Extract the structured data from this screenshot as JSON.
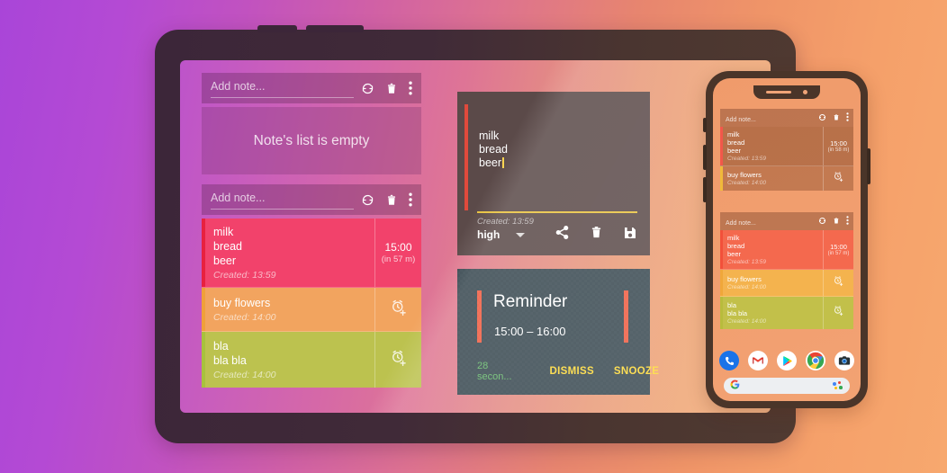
{
  "background": {
    "gradient_from": "#a945d8",
    "gradient_mid": "#dd7290",
    "gradient_to": "#f7a86e"
  },
  "tablet": {
    "bezel_color": "#3c2639",
    "empty_list_panel": {
      "toolbar": {
        "placeholder": "Add note...",
        "icons": [
          "sync-icon",
          "delete-icon",
          "overflow-menu-icon"
        ]
      },
      "empty_message": "Note's list is empty"
    },
    "notes_panel": {
      "toolbar": {
        "placeholder": "Add note...",
        "icons": [
          "sync-icon",
          "delete-icon",
          "overflow-menu-icon"
        ]
      },
      "notes": [
        {
          "lines": [
            "milk",
            "bread",
            "beer"
          ],
          "created": "Created: 13:59",
          "time": "15:00",
          "relative": "(in 57 m)",
          "color": "#f2426b",
          "bar_color": "#e8213f",
          "has_reminder": true
        },
        {
          "lines": [
            "buy flowers"
          ],
          "created": "Created: 14:00",
          "time": "",
          "relative": "",
          "color": "#f2a45f",
          "bar_color": "#f0a03a",
          "has_reminder": false
        },
        {
          "lines": [
            "bla",
            "bla bla"
          ],
          "created": "Created: 14:00",
          "time": "",
          "relative": "",
          "color": "#bcc24f",
          "bar_color": "#a8c23c",
          "has_reminder": false
        }
      ]
    },
    "editor": {
      "background": "#5b4a49",
      "accent_bar": "#e04a3c",
      "underline": "#e8c23f",
      "lines": [
        "milk",
        "bread",
        "beer"
      ],
      "created": "Created: 13:59",
      "priority": "high",
      "icons": [
        "share-icon",
        "delete-icon",
        "save-icon"
      ]
    },
    "reminder": {
      "background": "#37474f",
      "accent_bar": "#ef5a3f",
      "title": "Reminder",
      "time_range": "15:00 – 16:00",
      "countdown": "28 secon...",
      "countdown_color": "#66bb6a",
      "dismiss_label": "DISMISS",
      "snooze_label": "SNOOZE",
      "action_color": "#fdd835"
    }
  },
  "phone": {
    "bezel_color": "#4a3529",
    "wallpaper": "#f09b6b",
    "dark_panel": {
      "toolbar": {
        "placeholder": "Add note...",
        "icons": [
          "sync-icon",
          "delete-icon",
          "overflow-menu-icon"
        ]
      },
      "notes": [
        {
          "lines": [
            "milk",
            "bread",
            "beer"
          ],
          "created": "Created: 13:59",
          "time": "15:00",
          "relative": "(in 58 m)",
          "color": "rgba(150,85,52,0.62)",
          "bar_color": "#f2574a",
          "has_reminder": false
        },
        {
          "lines": [
            "buy flowers"
          ],
          "created": "Created: 14:00",
          "time": "",
          "relative": "",
          "color": "rgba(150,85,52,0.50)",
          "bar_color": "#f0b93a",
          "has_reminder": true
        }
      ]
    },
    "color_panel": {
      "toolbar": {
        "placeholder": "Add note...",
        "icons": [
          "sync-icon",
          "delete-icon",
          "overflow-menu-icon"
        ]
      },
      "notes": [
        {
          "lines": [
            "milk",
            "bread",
            "beer"
          ],
          "created": "Created: 13:59",
          "time": "15:00",
          "relative": "(in 57 m)",
          "color": "#f4694e",
          "bar_color": "#f2503a",
          "has_reminder": false
        },
        {
          "lines": [
            "buy flowers"
          ],
          "created": "Created: 14:00",
          "time": "",
          "relative": "",
          "color": "#f4b34e",
          "bar_color": "#f0a73a",
          "has_reminder": true
        },
        {
          "lines": [
            "bla",
            "bla bla"
          ],
          "created": "Created: 14:00",
          "time": "",
          "relative": "",
          "color": "#c2c04a",
          "bar_color": "#b8bc3c",
          "has_reminder": true
        }
      ]
    },
    "dock": {
      "apps": [
        "phone-icon",
        "gmail-icon",
        "play-store-icon",
        "chrome-icon",
        "camera-icon"
      ],
      "search": {
        "logo": "google-logo-icon",
        "assistant": "assistant-icon"
      }
    }
  }
}
